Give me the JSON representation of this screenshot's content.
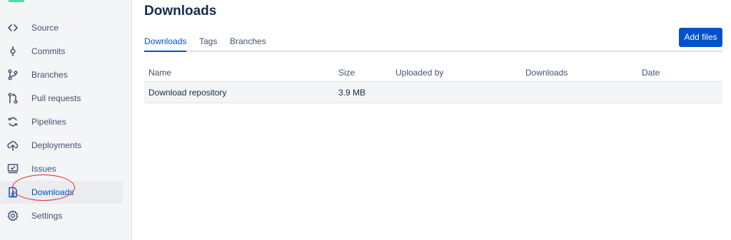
{
  "sidebar": {
    "items": [
      {
        "label": "Source",
        "icon": "code-icon"
      },
      {
        "label": "Commits",
        "icon": "commit-icon"
      },
      {
        "label": "Branches",
        "icon": "branch-icon"
      },
      {
        "label": "Pull requests",
        "icon": "pull-request-icon"
      },
      {
        "label": "Pipelines",
        "icon": "pipelines-icon"
      },
      {
        "label": "Deployments",
        "icon": "cloud-upload-icon"
      },
      {
        "label": "Issues",
        "icon": "issues-icon"
      },
      {
        "label": "Downloads",
        "icon": "downloads-icon"
      },
      {
        "label": "Settings",
        "icon": "gear-icon"
      }
    ],
    "active": "Downloads"
  },
  "main": {
    "title": "Downloads",
    "tabs": [
      {
        "label": "Downloads"
      },
      {
        "label": "Tags"
      },
      {
        "label": "Branches"
      }
    ],
    "active_tab": "Downloads",
    "add_files_label": "Add files",
    "table": {
      "columns": [
        "Name",
        "Size",
        "Uploaded by",
        "Downloads",
        "Date"
      ],
      "rows": [
        [
          "Download repository",
          "3.9 MB",
          "",
          "",
          ""
        ]
      ]
    }
  },
  "colors": {
    "accent": "#0052cc",
    "sidebar_bg": "#f4f5f7",
    "annotation": "#e0302b"
  }
}
